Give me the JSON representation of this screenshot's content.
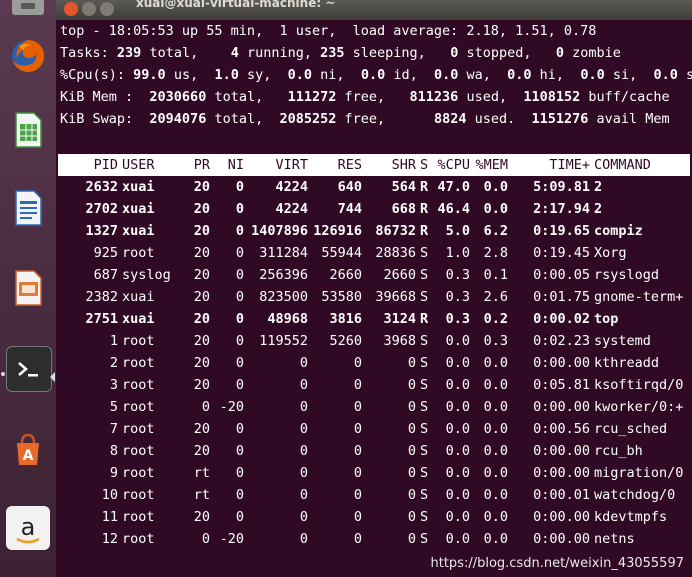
{
  "window": {
    "title": "xuai@xuai-virtual-machine: ~"
  },
  "launcher": {
    "items": [
      {
        "name": "files-icon"
      },
      {
        "name": "firefox-icon"
      },
      {
        "name": "libreoffice-calc-icon"
      },
      {
        "name": "libreoffice-writer-icon"
      },
      {
        "name": "libreoffice-impress-icon"
      },
      {
        "name": "terminal-icon"
      },
      {
        "name": "software-center-icon"
      },
      {
        "name": "amazon-icon"
      }
    ]
  },
  "summary": {
    "line1": "top - 18:05:53 up 55 min,  1 user,  load average: 2.18, 1.51, 0.78",
    "tasks": {
      "label": "Tasks:",
      "total": "239",
      "running": "4",
      "sleeping": "235",
      "stopped": "0",
      "zombie": "0"
    },
    "cpu": {
      "label": "%Cpu(s):",
      "us": "99.0",
      "sy": "1.0",
      "ni": "0.0",
      "id": "0.0",
      "wa": "0.0",
      "hi": "0.0",
      "si": "0.0",
      "st": "0.0"
    },
    "mem": {
      "label": "KiB Mem :",
      "total": "2030660",
      "free": "111272",
      "used": "811236",
      "buff": "1108152"
    },
    "swap": {
      "label": "KiB Swap:",
      "total": "2094076",
      "free": "2085252",
      "used": "8824",
      "avail": "1151276"
    }
  },
  "columns": [
    "PID",
    "USER",
    "PR",
    "NI",
    "VIRT",
    "RES",
    "SHR",
    "S",
    "%CPU",
    "%MEM",
    "TIME+",
    "COMMAND"
  ],
  "processes": [
    {
      "bold": true,
      "pid": "2632",
      "user": "xuai",
      "pr": "20",
      "ni": "0",
      "virt": "4224",
      "res": "640",
      "shr": "564",
      "s": "R",
      "cpu": "47.0",
      "mem": "0.0",
      "time": "5:09.81",
      "cmd": "2"
    },
    {
      "bold": true,
      "pid": "2702",
      "user": "xuai",
      "pr": "20",
      "ni": "0",
      "virt": "4224",
      "res": "744",
      "shr": "668",
      "s": "R",
      "cpu": "46.4",
      "mem": "0.0",
      "time": "2:17.94",
      "cmd": "2"
    },
    {
      "bold": true,
      "pid": "1327",
      "user": "xuai",
      "pr": "20",
      "ni": "0",
      "virt": "1407896",
      "res": "126916",
      "shr": "86732",
      "s": "R",
      "cpu": "5.0",
      "mem": "6.2",
      "time": "0:19.65",
      "cmd": "compiz"
    },
    {
      "bold": false,
      "pid": "925",
      "user": "root",
      "pr": "20",
      "ni": "0",
      "virt": "311284",
      "res": "55944",
      "shr": "28836",
      "s": "S",
      "cpu": "1.0",
      "mem": "2.8",
      "time": "0:19.45",
      "cmd": "Xorg"
    },
    {
      "bold": false,
      "pid": "687",
      "user": "syslog",
      "pr": "20",
      "ni": "0",
      "virt": "256396",
      "res": "2660",
      "shr": "2660",
      "s": "S",
      "cpu": "0.3",
      "mem": "0.1",
      "time": "0:00.05",
      "cmd": "rsyslogd"
    },
    {
      "bold": false,
      "pid": "2382",
      "user": "xuai",
      "pr": "20",
      "ni": "0",
      "virt": "823500",
      "res": "53580",
      "shr": "39668",
      "s": "S",
      "cpu": "0.3",
      "mem": "2.6",
      "time": "0:01.75",
      "cmd": "gnome-term+"
    },
    {
      "bold": true,
      "pid": "2751",
      "user": "xuai",
      "pr": "20",
      "ni": "0",
      "virt": "48968",
      "res": "3816",
      "shr": "3124",
      "s": "R",
      "cpu": "0.3",
      "mem": "0.2",
      "time": "0:00.02",
      "cmd": "top"
    },
    {
      "bold": false,
      "pid": "1",
      "user": "root",
      "pr": "20",
      "ni": "0",
      "virt": "119552",
      "res": "5260",
      "shr": "3968",
      "s": "S",
      "cpu": "0.0",
      "mem": "0.3",
      "time": "0:02.23",
      "cmd": "systemd"
    },
    {
      "bold": false,
      "pid": "2",
      "user": "root",
      "pr": "20",
      "ni": "0",
      "virt": "0",
      "res": "0",
      "shr": "0",
      "s": "S",
      "cpu": "0.0",
      "mem": "0.0",
      "time": "0:00.00",
      "cmd": "kthreadd"
    },
    {
      "bold": false,
      "pid": "3",
      "user": "root",
      "pr": "20",
      "ni": "0",
      "virt": "0",
      "res": "0",
      "shr": "0",
      "s": "S",
      "cpu": "0.0",
      "mem": "0.0",
      "time": "0:05.81",
      "cmd": "ksoftirqd/0"
    },
    {
      "bold": false,
      "pid": "5",
      "user": "root",
      "pr": "0",
      "ni": "-20",
      "virt": "0",
      "res": "0",
      "shr": "0",
      "s": "S",
      "cpu": "0.0",
      "mem": "0.0",
      "time": "0:00.00",
      "cmd": "kworker/0:+"
    },
    {
      "bold": false,
      "pid": "7",
      "user": "root",
      "pr": "20",
      "ni": "0",
      "virt": "0",
      "res": "0",
      "shr": "0",
      "s": "S",
      "cpu": "0.0",
      "mem": "0.0",
      "time": "0:00.56",
      "cmd": "rcu_sched"
    },
    {
      "bold": false,
      "pid": "8",
      "user": "root",
      "pr": "20",
      "ni": "0",
      "virt": "0",
      "res": "0",
      "shr": "0",
      "s": "S",
      "cpu": "0.0",
      "mem": "0.0",
      "time": "0:00.00",
      "cmd": "rcu_bh"
    },
    {
      "bold": false,
      "pid": "9",
      "user": "root",
      "pr": "rt",
      "ni": "0",
      "virt": "0",
      "res": "0",
      "shr": "0",
      "s": "S",
      "cpu": "0.0",
      "mem": "0.0",
      "time": "0:00.00",
      "cmd": "migration/0"
    },
    {
      "bold": false,
      "pid": "10",
      "user": "root",
      "pr": "rt",
      "ni": "0",
      "virt": "0",
      "res": "0",
      "shr": "0",
      "s": "S",
      "cpu": "0.0",
      "mem": "0.0",
      "time": "0:00.01",
      "cmd": "watchdog/0"
    },
    {
      "bold": false,
      "pid": "11",
      "user": "root",
      "pr": "20",
      "ni": "0",
      "virt": "0",
      "res": "0",
      "shr": "0",
      "s": "S",
      "cpu": "0.0",
      "mem": "0.0",
      "time": "0:00.00",
      "cmd": "kdevtmpfs"
    },
    {
      "bold": false,
      "pid": "12",
      "user": "root",
      "pr": "0",
      "ni": "-20",
      "virt": "0",
      "res": "0",
      "shr": "0",
      "s": "S",
      "cpu": "0.0",
      "mem": "0.0",
      "time": "0:00.00",
      "cmd": "netns"
    }
  ],
  "watermark": "https://blog.csdn.net/weixin_43055597",
  "colors": {
    "terminal_bg": "#300a24",
    "header_bg": "#ffffff",
    "text": "#ffffff"
  }
}
